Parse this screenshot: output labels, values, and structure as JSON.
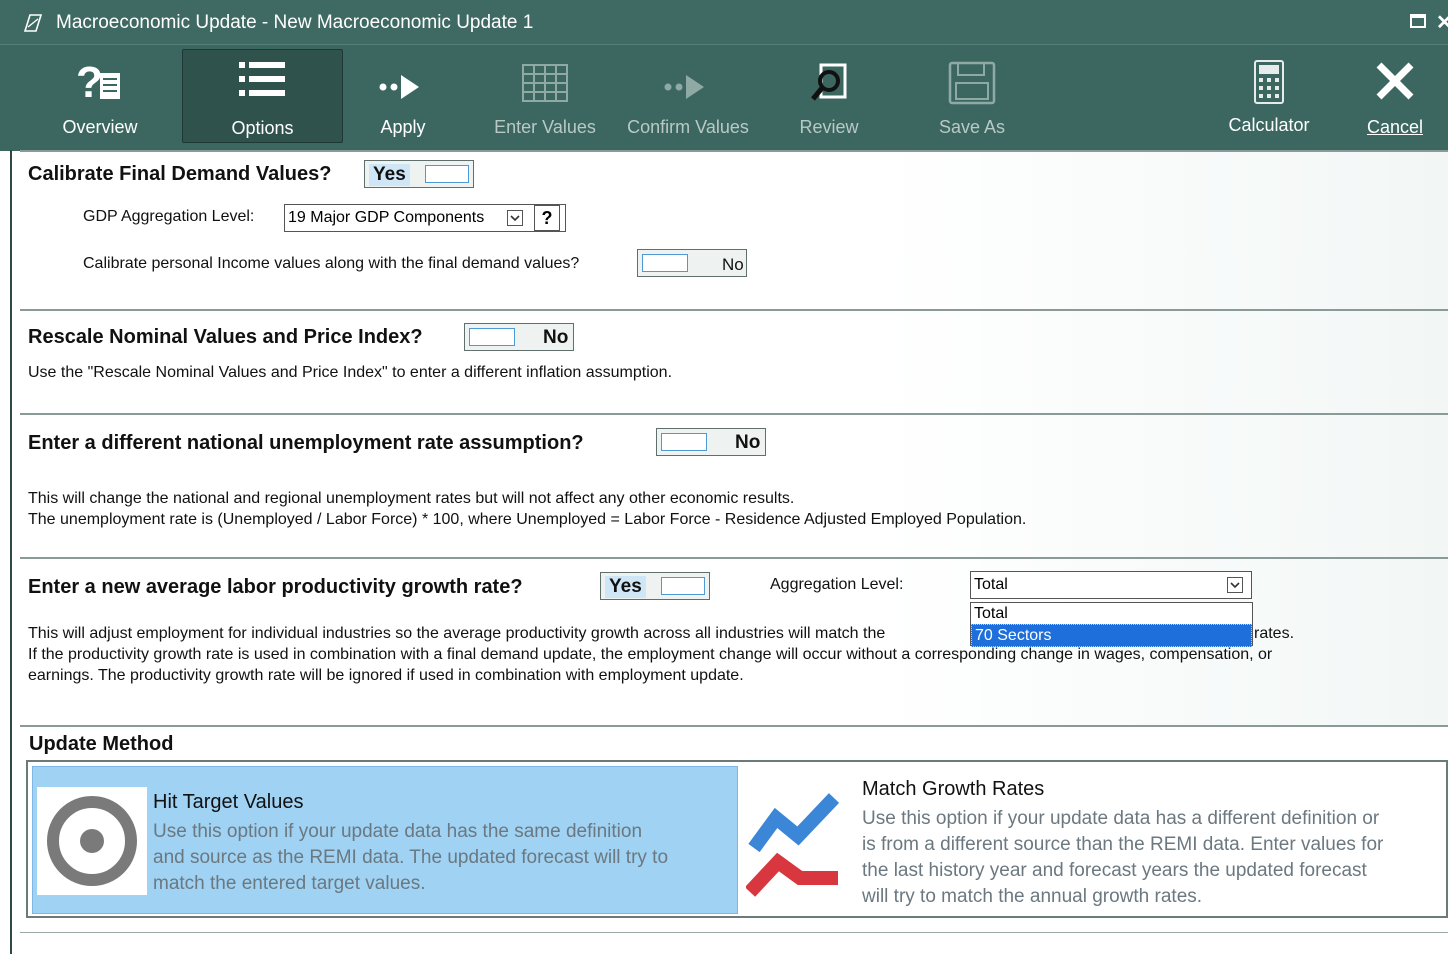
{
  "window": {
    "title": "Macroeconomic Update - New Macroeconomic Update 1"
  },
  "toolbar": {
    "overview": "Overview",
    "options": "Options",
    "apply": "Apply",
    "enter_values": "Enter Values",
    "confirm_values": "Confirm Values",
    "review": "Review",
    "save_as": "Save As",
    "calculator": "Calculator",
    "cancel": "Cancel"
  },
  "calibrate": {
    "heading": "Calibrate Final Demand Values?",
    "toggle": "Yes",
    "gdp_label": "GDP Aggregation Level:",
    "gdp_value": "19 Major GDP Components",
    "help": "?",
    "personal_label": "Calibrate personal Income values along with the final demand values?",
    "personal_toggle": "No"
  },
  "rescale": {
    "heading": "Rescale Nominal Values and Price Index?",
    "toggle": "No",
    "description": "Use the \"Rescale Nominal Values and Price Index\" to enter a different inflation assumption."
  },
  "unemployment": {
    "heading": "Enter a different national unemployment rate assumption?",
    "toggle": "No",
    "line1": "This will change the national and regional unemployment rates but will not affect any other economic results.",
    "line2": "The unemployment rate is (Unemployed / Labor Force) * 100, where Unemployed = Labor Force - Residence Adjusted Employed Population."
  },
  "productivity": {
    "heading": "Enter a new average labor productivity growth rate?",
    "toggle": "Yes",
    "agg_label": "Aggregation Level:",
    "agg_value": "Total",
    "options": [
      "Total",
      "70 Sectors"
    ],
    "line1_a": "This will adjust employment for individual industries so the average productivity growth across all industries will match the",
    "line1_b": "rates.",
    "line2": "If the productivity growth rate is used in combination with a final demand update, the employment change will occur without a corresponding change in wages, compensation, or",
    "line3": "earnings. The productivity growth rate will be ignored if used in combination with employment update."
  },
  "update_method": {
    "heading": "Update Method",
    "hit": {
      "title": "Hit Target Values",
      "desc1": "Use this option if your update data has the same definition",
      "desc2": "and source as the REMI data. The updated forecast will try to",
      "desc3": "match the entered target values."
    },
    "match": {
      "title": "Match Growth Rates",
      "desc1": "Use this option if your update data has a different definition or",
      "desc2": "is from a different source than the REMI data. Enter values for",
      "desc3": "the last history year and forecast years the updated forecast",
      "desc4": "will try to match the annual growth rates."
    }
  },
  "colors": {
    "toolbar": "#3c6761",
    "selected_card": "#9fd2f3",
    "dropdown_highlight": "#1e6fdc"
  }
}
